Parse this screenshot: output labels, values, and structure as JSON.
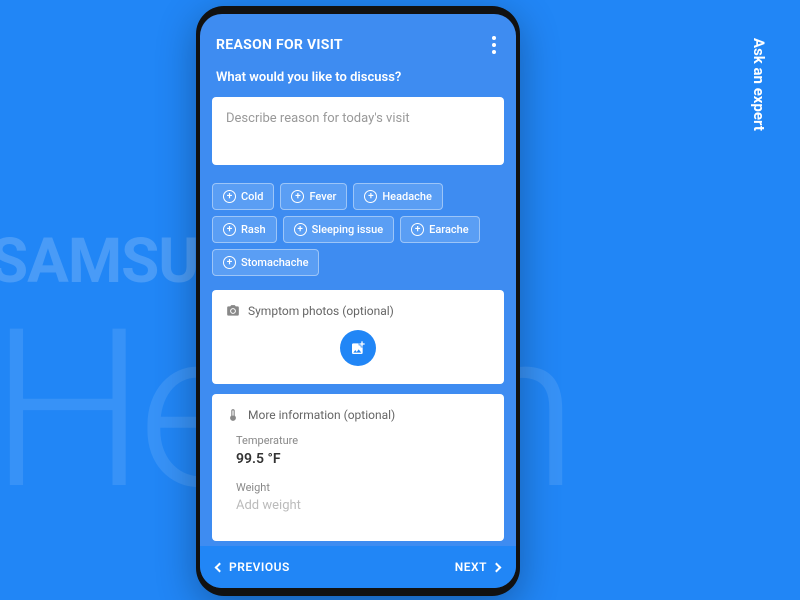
{
  "background": {
    "brand1": "SAMSUNG",
    "brand2": "Health",
    "vertical": "Ask an expert"
  },
  "header": {
    "title": "REASON FOR VISIT"
  },
  "question": "What would you like to discuss?",
  "reason": {
    "placeholder": "Describe reason for today's visit"
  },
  "chips": [
    "Cold",
    "Fever",
    "Headache",
    "Rash",
    "Sleeping issue",
    "Earache",
    "Stomachache"
  ],
  "photos": {
    "title": "Symptom photos (optional)"
  },
  "info": {
    "title": "More information (optional)",
    "temperature": {
      "label": "Temperature",
      "value": "99.5 °F"
    },
    "weight": {
      "label": "Weight",
      "placeholder": "Add weight"
    }
  },
  "footer": {
    "prev": "PREVIOUS",
    "next": "NEXT"
  }
}
